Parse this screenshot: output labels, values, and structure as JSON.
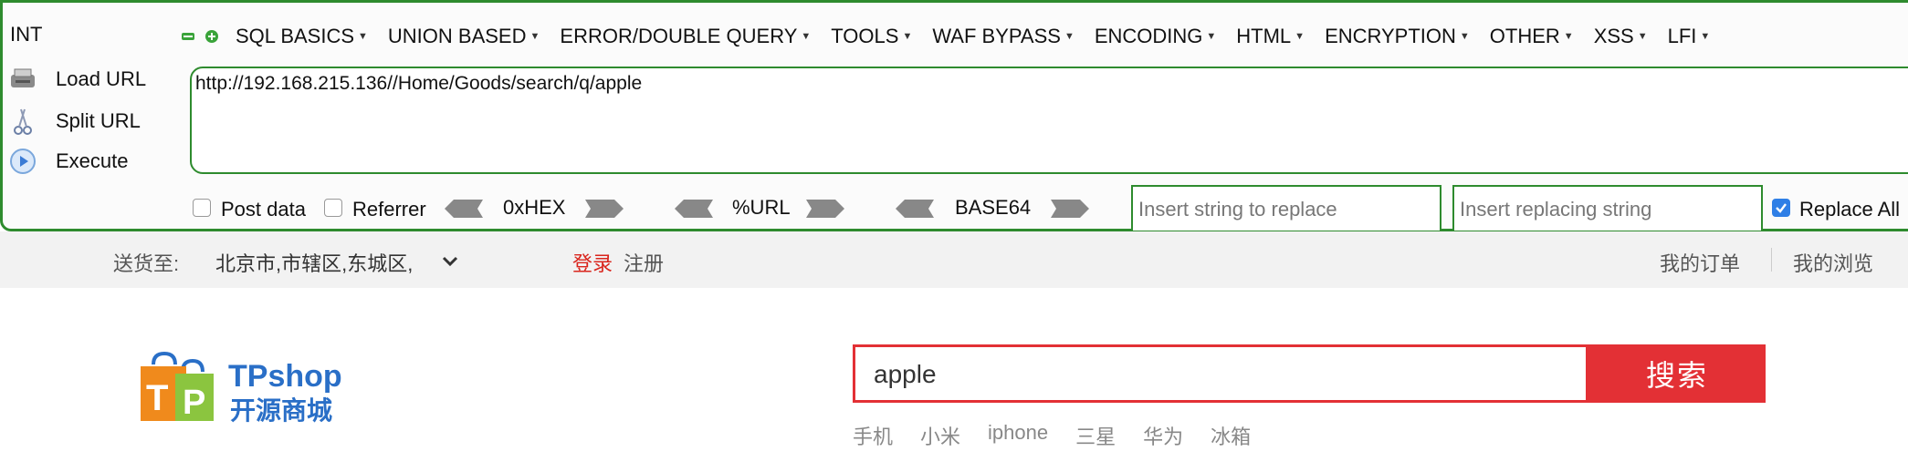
{
  "hackbar": {
    "int_label": "INT",
    "menu": [
      "SQL BASICS",
      "UNION BASED",
      "ERROR/DOUBLE QUERY",
      "TOOLS",
      "WAF BYPASS",
      "ENCODING",
      "HTML",
      "ENCRYPTION",
      "OTHER",
      "XSS",
      "LFI"
    ],
    "actions": {
      "load": "Load URL",
      "split": "Split URL",
      "execute": "Execute"
    },
    "url_value": "http://192.168.215.136//Home/Goods/search/q/apple",
    "post_data": "Post data",
    "referrer": "Referrer",
    "hex_label": "0xHEX",
    "url_label": "%URL",
    "b64_label": "BASE64",
    "replace_placeholder": "Insert string to replace",
    "replacing_placeholder": "Insert replacing string",
    "replace_all": "Replace All",
    "colors": {
      "accent": "#2e8b2e"
    }
  },
  "site": {
    "ship_label": "送货至:",
    "location": "北京市,市辖区,东城区,",
    "login": "登录",
    "register": "注册",
    "orders": "我的订单",
    "history": "我的浏览",
    "logo_brand": "TPshop",
    "logo_sub": "开源商城",
    "search_value": "apple",
    "search_button": "搜索",
    "hot": [
      "手机",
      "小米",
      "iphone",
      "三星",
      "华为",
      "冰箱"
    ],
    "colors": {
      "brand_red": "#e33035",
      "logo_blue": "#2a6fc7",
      "logo_orange": "#f08a1c"
    }
  }
}
